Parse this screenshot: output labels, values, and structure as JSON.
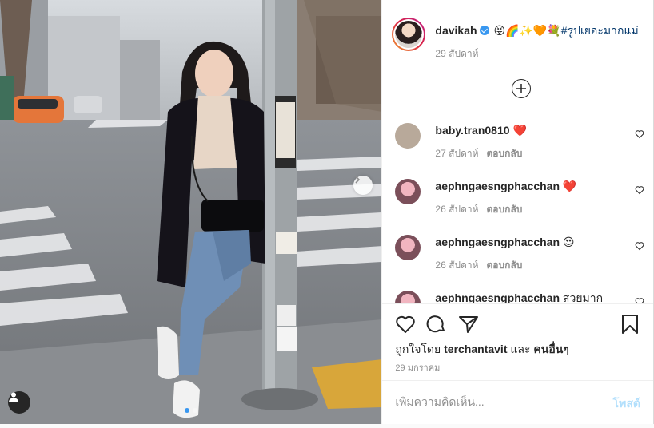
{
  "post": {
    "username": "davikah",
    "verified": true,
    "caption_emoji": "😝🌈✨🧡💐",
    "hashtag": "#รูปเยอะมากแม่",
    "time": "29 สัปดาห์",
    "load_more_icon": "plus-circle-icon"
  },
  "comments": [
    {
      "username": "baby.tran0810",
      "text": "❤️",
      "time": "27 สัปดาห์",
      "reply": "ตอบกลับ",
      "avatar_color": "#b8a99a"
    },
    {
      "username": "aephngaesngphacchan",
      "text": "❤️",
      "time": "26 สัปดาห์",
      "reply": "ตอบกลับ",
      "avatar_color": "#c9a0a8"
    },
    {
      "username": "aephngaesngphacchan",
      "text": "😍",
      "time": "26 สัปดาห์",
      "reply": "ตอบกลับ",
      "avatar_color": "#c9a0a8"
    },
    {
      "username": "aephngaesngphacchan",
      "text": "สวยมาก",
      "time": "",
      "reply": "",
      "avatar_color": "#c9a0a8"
    }
  ],
  "actions": {
    "like_icon": "heart-icon",
    "comment_icon": "comment-icon",
    "share_icon": "share-icon",
    "save_icon": "bookmark-icon"
  },
  "likes": {
    "prefix": "ถูกใจโดย",
    "user": "terchantavit",
    "conj": "และ",
    "others": "คนอื่นๆ"
  },
  "date": "29 มกราคม",
  "comment_input": {
    "placeholder": "เพิ่มความคิดเห็น..."
  },
  "post_button": "โพสต์",
  "carousel": {
    "slides": 2,
    "active": 1
  },
  "colors": {
    "link": "#003569",
    "post_button": "#b2dffc",
    "heart": "#ed4956",
    "dot_active": "#3897f0"
  }
}
